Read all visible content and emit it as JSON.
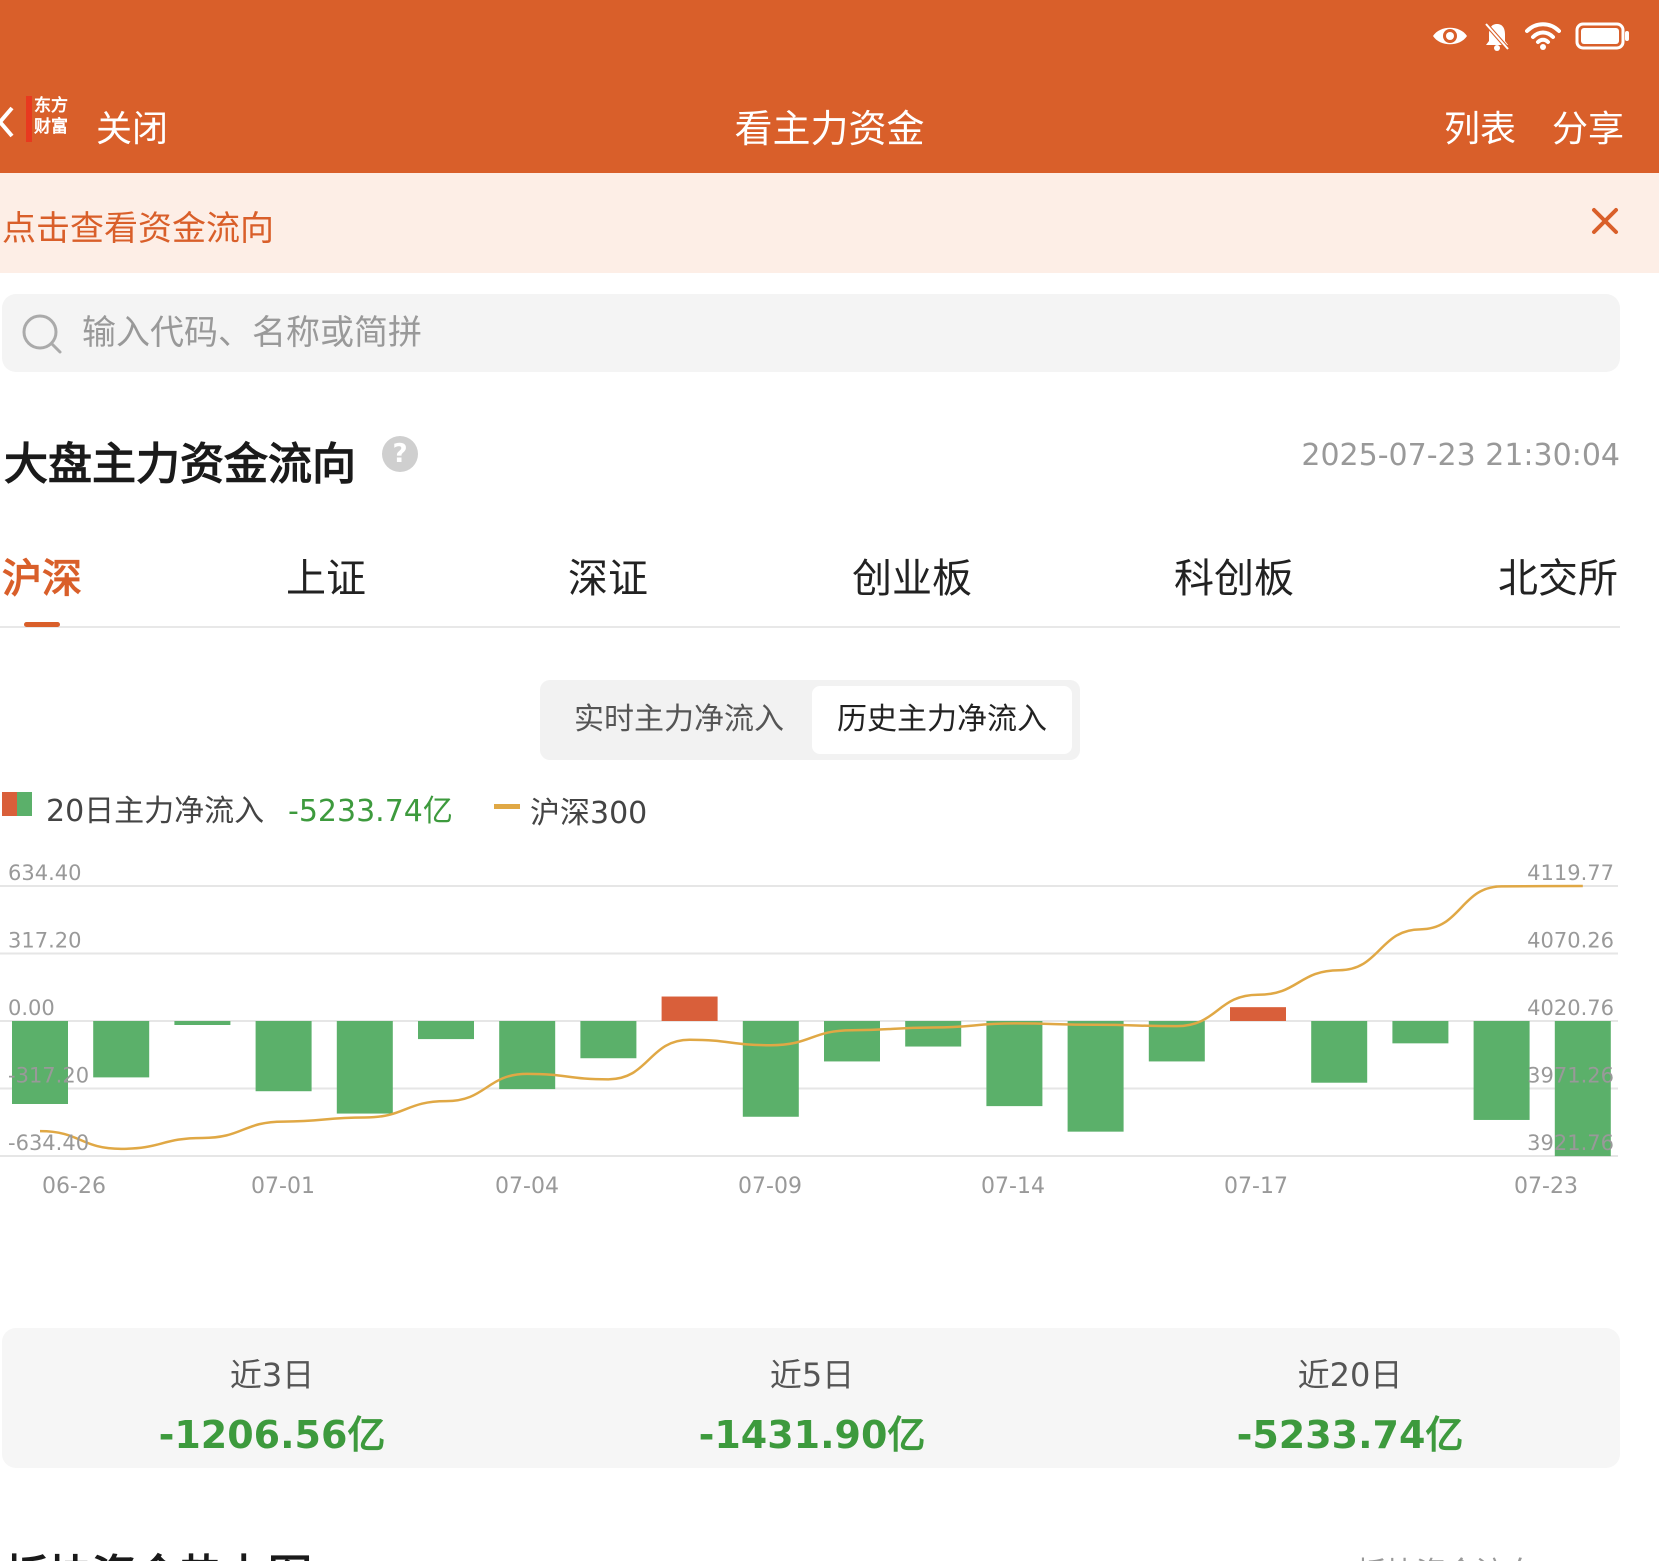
{
  "nav": {
    "close_label": "关闭",
    "title": "看主力资金",
    "list_label": "列表",
    "share_label": "分享",
    "logo_line1": "东方",
    "logo_line2": "财富",
    "brand_color": "#d95f2a"
  },
  "status_icons": [
    "eye-icon",
    "bell-off-icon",
    "wifi-icon",
    "battery-icon"
  ],
  "banner": {
    "text": "点击查看资金流向"
  },
  "search": {
    "placeholder": "输入代码、名称或简拼"
  },
  "section": {
    "title": "大盘主力资金流向",
    "help": "?",
    "timestamp": "2025-07-23 21:30:04"
  },
  "market_tabs": [
    {
      "label": "沪深",
      "active": true
    },
    {
      "label": "上证",
      "active": false
    },
    {
      "label": "深证",
      "active": false
    },
    {
      "label": "创业板",
      "active": false
    },
    {
      "label": "科创板",
      "active": false
    },
    {
      "label": "北交所",
      "active": false
    }
  ],
  "segment": {
    "realtime_label": "实时主力净流入",
    "history_label": "历史主力净流入",
    "selected": "history"
  },
  "legend": {
    "bar_label": "20日主力净流入",
    "bar_value": "-5233.74亿",
    "line_label": "沪深300"
  },
  "chart_data": {
    "type": "bar",
    "left_axis": {
      "ticks": [
        "634.40",
        "317.20",
        "0.00",
        "-317.20",
        "-634.40"
      ],
      "ylim": [
        -634.4,
        634.4
      ]
    },
    "right_axis": {
      "ticks": [
        "4119.77",
        "4070.26",
        "4020.76",
        "3971.26",
        "3921.76"
      ],
      "ylim": [
        3921.76,
        4119.77
      ]
    },
    "x_tick_labels": [
      "06-26",
      "07-01",
      "07-04",
      "07-09",
      "07-14",
      "07-17",
      "07-23"
    ],
    "categories": [
      "06-26",
      "06-27",
      "06-30",
      "07-01",
      "07-02",
      "07-03",
      "07-04",
      "07-07",
      "07-08",
      "07-09",
      "07-10",
      "07-11",
      "07-14",
      "07-15",
      "07-16",
      "07-17",
      "07-18",
      "07-21",
      "07-22",
      "07-23"
    ],
    "series": [
      {
        "axis": "left",
        "type": "bar",
        "values": [
          -390,
          -265,
          -15,
          -330,
          -435,
          -85,
          -320,
          -175,
          115,
          -450,
          -190,
          -120,
          -400,
          -520,
          -190,
          65,
          -290,
          -105,
          -465,
          -635
        ]
      },
      {
        "axis": "right",
        "type": "line",
        "values": [
          3940,
          3927,
          3935,
          3947,
          3950,
          3962,
          3982,
          3978,
          4007,
          4003,
          4014,
          4016,
          4019,
          4018,
          4017,
          4040,
          4058,
          4088,
          4119.5,
          4119.77
        ]
      }
    ],
    "colors": {
      "positive": "#d95f3a",
      "negative": "#5bb06a",
      "line": "#e0a845"
    },
    "grid": true
  },
  "summary": [
    {
      "label": "近3日",
      "value": "-1206.56亿"
    },
    {
      "label": "近5日",
      "value": "-1431.90亿"
    },
    {
      "label": "近20日",
      "value": "-5233.74亿"
    }
  ],
  "bottom_peek": {
    "left": "板块资金热力图",
    "right": "板块资金流向"
  }
}
